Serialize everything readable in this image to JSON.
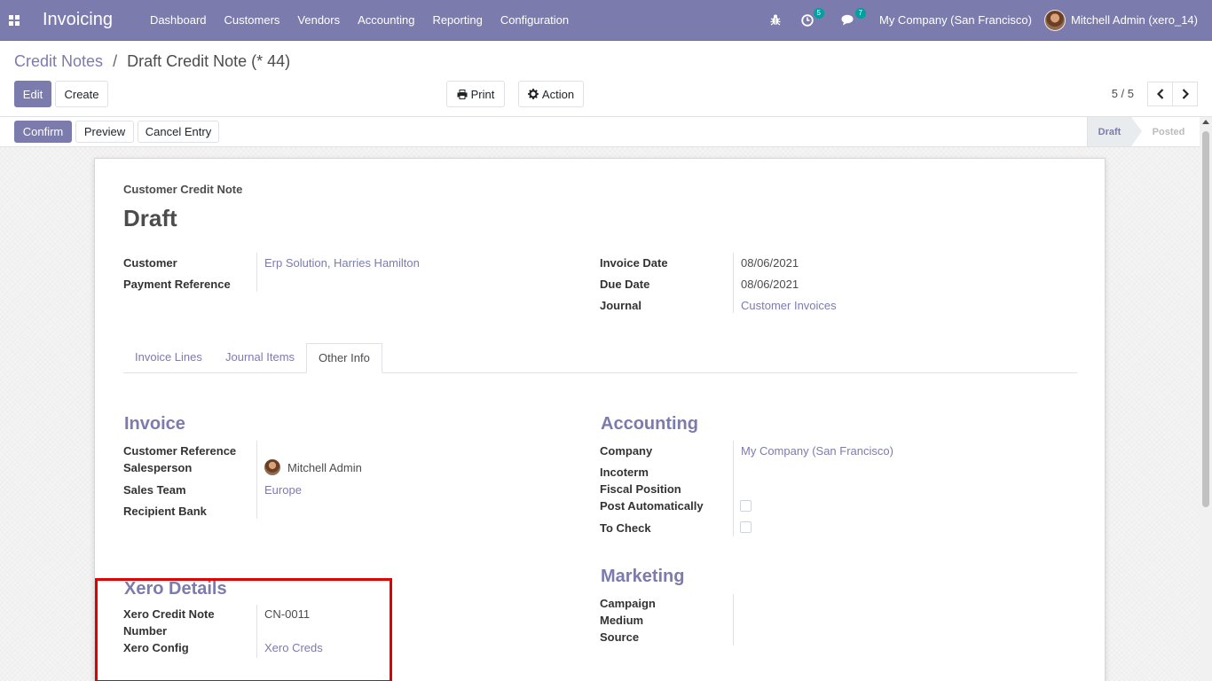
{
  "navbar": {
    "app_title": "Invoicing",
    "menu": [
      "Dashboard",
      "Customers",
      "Vendors",
      "Accounting",
      "Reporting",
      "Configuration"
    ],
    "activity_count": "5",
    "message_count": "7",
    "company": "My Company (San Francisco)",
    "user": "Mitchell Admin (xero_14)",
    "icons": [
      "apps-icon",
      "bug-icon",
      "clock-icon",
      "chat-icon"
    ]
  },
  "breadcrumb": {
    "parent": "Credit Notes",
    "separator": "/",
    "current": "Draft Credit Note (* 44)"
  },
  "toolbar": {
    "edit": "Edit",
    "create": "Create",
    "print": "Print",
    "action": "Action",
    "pager": "5 / 5"
  },
  "statusbar": {
    "confirm": "Confirm",
    "preview": "Preview",
    "cancel_entry": "Cancel Entry",
    "stages": [
      "Draft",
      "Posted"
    ],
    "active_stage": "Draft"
  },
  "form": {
    "doc_type": "Customer Credit Note",
    "title": "Draft",
    "left_fields": {
      "customer_label": "Customer",
      "customer_value": "Erp Solution, Harries Hamilton",
      "payment_reference_label": "Payment Reference",
      "payment_reference_value": ""
    },
    "right_fields": {
      "invoice_date_label": "Invoice Date",
      "invoice_date_value": "08/06/2021",
      "due_date_label": "Due Date",
      "due_date_value": "08/06/2021",
      "journal_label": "Journal",
      "journal_value": "Customer Invoices"
    },
    "tabs": [
      "Invoice Lines",
      "Journal Items",
      "Other Info"
    ],
    "active_tab": "Other Info",
    "invoice_section": {
      "title": "Invoice",
      "customer_reference_label": "Customer Reference",
      "salesperson_label": "Salesperson",
      "salesperson_value": "Mitchell Admin",
      "sales_team_label": "Sales Team",
      "sales_team_value": "Europe",
      "recipient_bank_label": "Recipient Bank"
    },
    "accounting_section": {
      "title": "Accounting",
      "company_label": "Company",
      "company_value": "My Company (San Francisco)",
      "incoterm_label": "Incoterm",
      "fiscal_position_label": "Fiscal Position",
      "post_automatically_label": "Post Automatically",
      "post_automatically_checked": false,
      "to_check_label": "To Check",
      "to_check_checked": false
    },
    "xero_section": {
      "title": "Xero Details",
      "credit_note_number_label_1": "Xero Credit Note",
      "credit_note_number_label_2": "Number",
      "credit_note_number_value": "CN-0011",
      "config_label": "Xero Config",
      "config_value": "Xero Creds"
    },
    "marketing_section": {
      "title": "Marketing",
      "campaign_label": "Campaign",
      "medium_label": "Medium",
      "source_label": "Source"
    }
  },
  "colors": {
    "primary": "#7c7bad",
    "highlight": "#e00000"
  }
}
